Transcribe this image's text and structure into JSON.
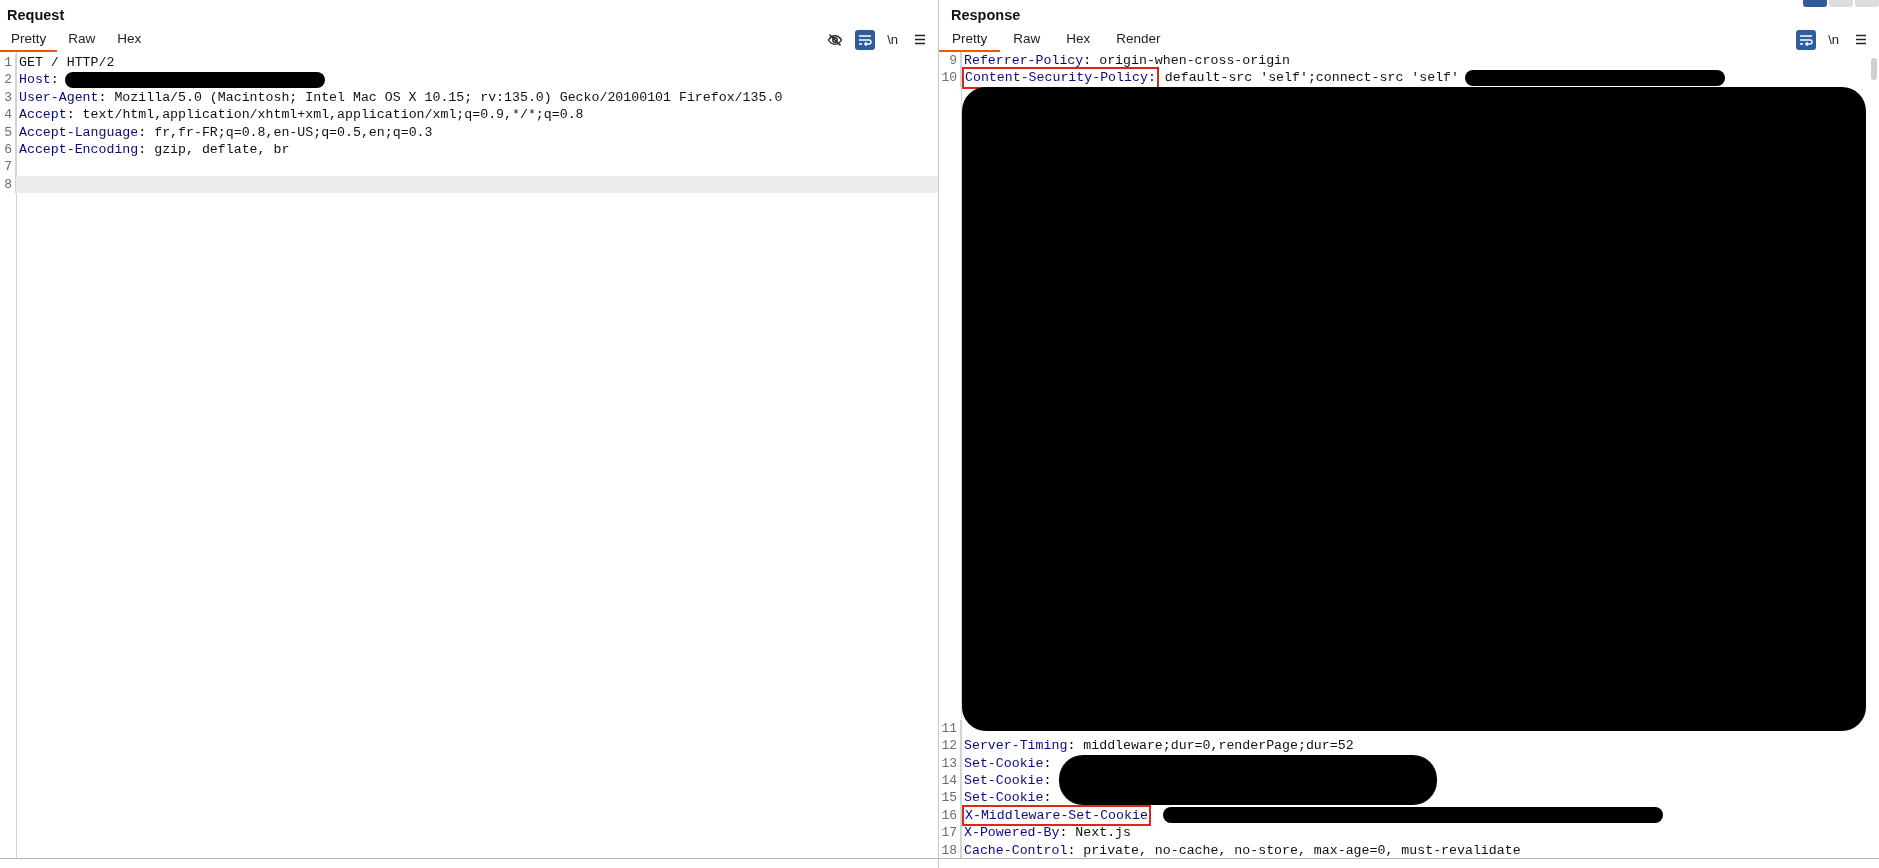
{
  "request": {
    "title": "Request",
    "tabs": [
      {
        "label": "Pretty",
        "selected": true
      },
      {
        "label": "Raw",
        "selected": false
      },
      {
        "label": "Hex",
        "selected": false
      }
    ],
    "toolbar": {
      "hide_toggle": true,
      "wrap_on": true,
      "newline_label": "\\n"
    },
    "lines": [
      {
        "kind": "line",
        "number": "1",
        "text": "GET / HTTP/2",
        "selected": false
      },
      {
        "kind": "line-redacted",
        "number": "2",
        "key": "Host",
        "colon": ":",
        "outlined": false,
        "selected": false
      },
      {
        "kind": "line",
        "number": "3",
        "key": "User-Agent",
        "colon": ":",
        "outlined": false,
        "text": "Mozilla/5.0 (Macintosh; Intel Mac OS X 10.15; rv:135.0) Gecko/20100101 Firefox/135.0",
        "selected": false
      },
      {
        "kind": "line",
        "number": "4",
        "key": "Accept",
        "colon": ":",
        "outlined": false,
        "text": "text/html,application/xhtml+xml,application/xml;q=0.9,*/*;q=0.8",
        "selected": false
      },
      {
        "kind": "line",
        "number": "5",
        "key": "Accept-Language",
        "colon": ":",
        "outlined": false,
        "text": "fr,fr-FR;q=0.8,en-US;q=0.5,en;q=0.3",
        "selected": false
      },
      {
        "kind": "line",
        "number": "6",
        "key": "Accept-Encoding",
        "colon": ":",
        "outlined": false,
        "text": "gzip, deflate, br",
        "selected": false
      },
      {
        "kind": "line",
        "number": "7",
        "selected": false
      },
      {
        "kind": "line",
        "number": "8",
        "selected": true
      }
    ]
  },
  "response": {
    "title": "Response",
    "tabs": [
      {
        "label": "Pretty",
        "selected": true
      },
      {
        "label": "Raw",
        "selected": false
      },
      {
        "label": "Hex",
        "selected": false
      },
      {
        "label": "Render",
        "selected": false
      }
    ],
    "toolbar": {
      "wrap_on": true,
      "newline_label": "\\n"
    },
    "lines": [
      {
        "kind": "line",
        "number": "9",
        "key": "Referrer-Policy",
        "colon": ":",
        "outlined": false,
        "text": "origin-when-cross-origin",
        "selected": false
      },
      {
        "kind": "line-redacted",
        "number": "10",
        "key": "Content-Security-Policy",
        "colon": ":",
        "outlined": true,
        "text": "default-src 'self';connect-src 'self'",
        "selected": false
      },
      {
        "kind": "blackout"
      },
      {
        "kind": "line",
        "number": "11",
        "selected": false
      },
      {
        "kind": "line",
        "number": "12",
        "key": "Server-Timing",
        "colon": ":",
        "outlined": false,
        "text": "middleware;dur=0,renderPage;dur=52",
        "selected": false
      },
      {
        "kind": "line-redacted-tall",
        "number": "13",
        "key": "Set-Cookie",
        "colon": ":",
        "outlined": false,
        "selected": false
      },
      {
        "kind": "line",
        "number": "14",
        "key": "Set-Cookie",
        "colon": ":",
        "outlined": false,
        "selected": false
      },
      {
        "kind": "line",
        "number": "15",
        "key": "Set-Cookie",
        "colon": ":",
        "outlined": false,
        "selected": false
      },
      {
        "kind": "line-redacted-long",
        "number": "16",
        "key": "X-Middleware-Set-Cookie",
        "outlined": true,
        "selected": false
      },
      {
        "kind": "line",
        "number": "17",
        "key": "X-Powered-By",
        "colon": ":",
        "outlined": false,
        "text": "Next.js",
        "selected": false
      },
      {
        "kind": "line",
        "number": "18",
        "key": "Cache-Control",
        "colon": ":",
        "outlined": false,
        "text": "private, no-cache, no-store, max-age=0, must-revalidate",
        "selected": false
      }
    ]
  }
}
